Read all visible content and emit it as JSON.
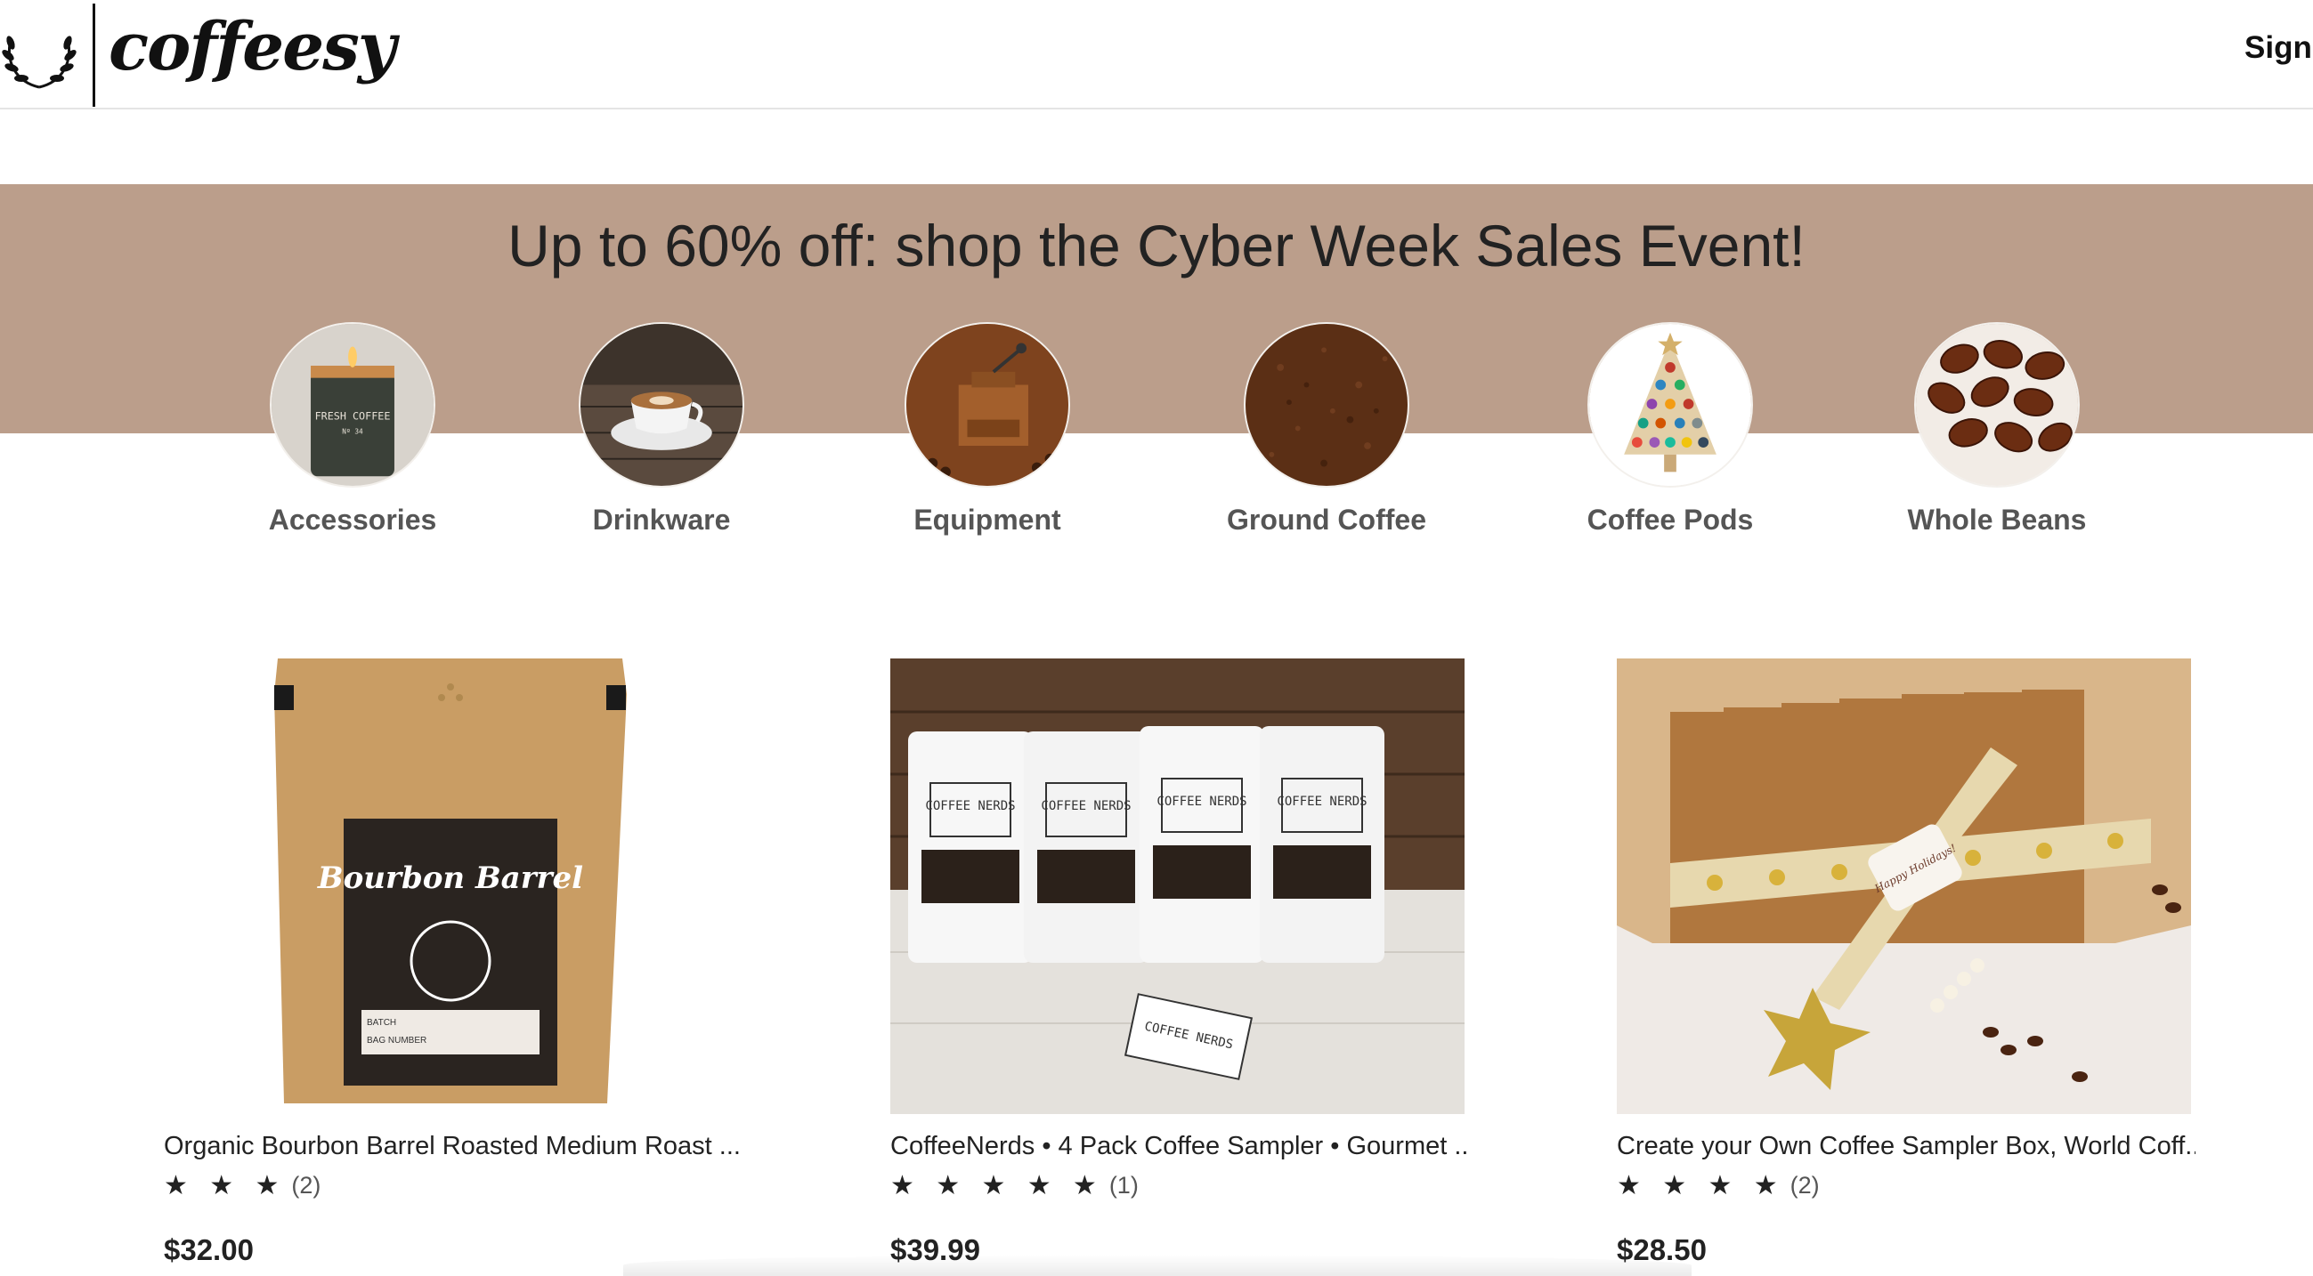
{
  "header": {
    "logo_text": "coffeesy",
    "logo_icon": "laurel-wreath-icon",
    "signin_label": "Sign I"
  },
  "banner": {
    "title": "Up to 60% off: shop the Cyber Week Sales Event!",
    "background_color": "#bb9e8b"
  },
  "categories": [
    {
      "label": "Accessories",
      "image": "candle-jar-image"
    },
    {
      "label": "Drinkware",
      "image": "coffee-cup-image"
    },
    {
      "label": "Equipment",
      "image": "coffee-grinder-image"
    },
    {
      "label": "Ground Coffee",
      "image": "ground-coffee-image"
    },
    {
      "label": "Coffee Pods",
      "image": "pod-tree-image"
    },
    {
      "label": "Whole Beans",
      "image": "coffee-beans-image"
    }
  ],
  "products": [
    {
      "title": "Organic Bourbon Barrel Roasted Medium Roast ...",
      "stars": "★ ★ ★",
      "rating_value": 3,
      "review_count": "(2)",
      "price": "$32.00",
      "image_text": "Bourbon Barrel"
    },
    {
      "title": "CoffeeNerds • 4 Pack Coffee Sampler • Gourmet ...",
      "stars": "★ ★ ★ ★ ★",
      "rating_value": 5,
      "review_count": "(1)",
      "price": "$39.99",
      "image_text": "COFFEE NERDS"
    },
    {
      "title": "Create your Own Coffee Sampler Box, World Coff..",
      "stars": "★ ★ ★ ★",
      "rating_value": 4,
      "review_count": "(2)",
      "price": "$28.50",
      "image_text": "Happy Holidays!"
    }
  ]
}
